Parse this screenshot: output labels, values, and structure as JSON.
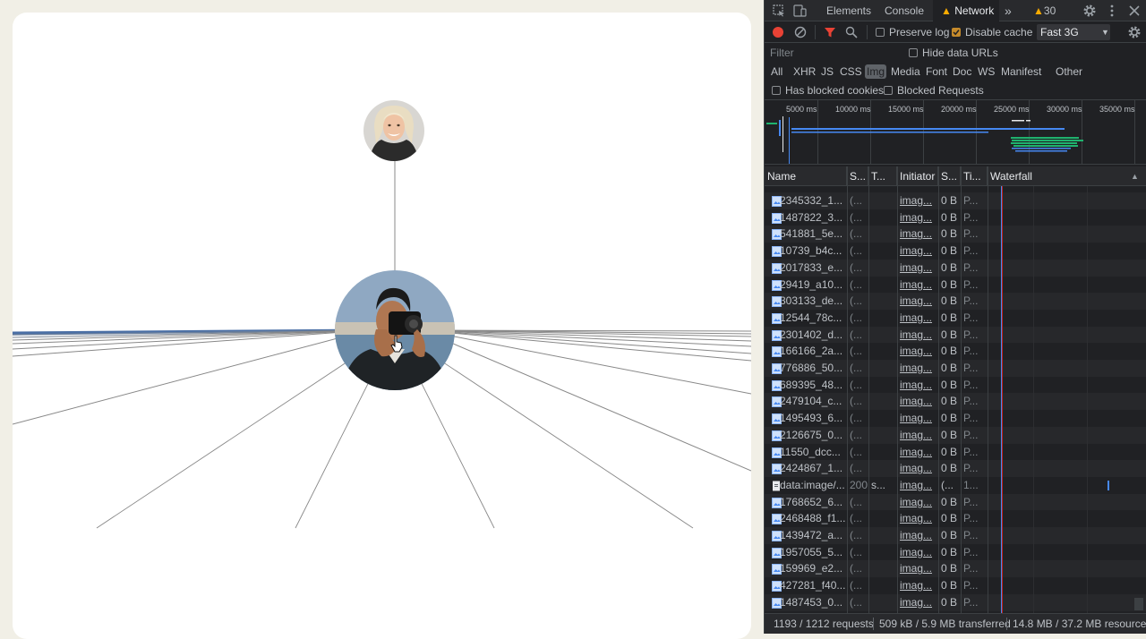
{
  "devtools": {
    "tabs": [
      "Elements",
      "Console",
      "Network"
    ],
    "selected_tab": "Network",
    "warning_count": "30",
    "toolbar": {
      "preserve_log": "Preserve log",
      "preserve_log_checked": false,
      "disable_cache": "Disable cache",
      "disable_cache_checked": true,
      "throttling": "Fast 3G"
    },
    "filter": {
      "placeholder": "Filter",
      "hide_data_urls": "Hide data URLs"
    },
    "types": [
      "All",
      "XHR",
      "JS",
      "CSS",
      "Img",
      "Media",
      "Font",
      "Doc",
      "WS",
      "Manifest",
      "Other"
    ],
    "selected_type": "Img",
    "has_blocked_cookies": "Has blocked cookies",
    "blocked_requests": "Blocked Requests",
    "overview_ticks": [
      "5000 ms",
      "10000 ms",
      "15000 ms",
      "20000 ms",
      "25000 ms",
      "30000 ms",
      "35000 ms"
    ],
    "columns": [
      "Name",
      "S...",
      "T...",
      "Initiator",
      "S...",
      "Ti...",
      "Waterfall"
    ],
    "rows": [
      {
        "name": "2345332_1...",
        "status": "(...",
        "type": "",
        "initiator": "imag...",
        "size": "0 B",
        "time": "P..."
      },
      {
        "name": "1487822_3...",
        "status": "(...",
        "type": "",
        "initiator": "imag...",
        "size": "0 B",
        "time": "P..."
      },
      {
        "name": "541881_5e...",
        "status": "(...",
        "type": "",
        "initiator": "imag...",
        "size": "0 B",
        "time": "P..."
      },
      {
        "name": "10739_b4c...",
        "status": "(...",
        "type": "",
        "initiator": "imag...",
        "size": "0 B",
        "time": "P..."
      },
      {
        "name": "2017833_e...",
        "status": "(...",
        "type": "",
        "initiator": "imag...",
        "size": "0 B",
        "time": "P..."
      },
      {
        "name": "29419_a10...",
        "status": "(...",
        "type": "",
        "initiator": "imag...",
        "size": "0 B",
        "time": "P..."
      },
      {
        "name": "303133_de...",
        "status": "(...",
        "type": "",
        "initiator": "imag...",
        "size": "0 B",
        "time": "P..."
      },
      {
        "name": "12544_78c...",
        "status": "(...",
        "type": "",
        "initiator": "imag...",
        "size": "0 B",
        "time": "P..."
      },
      {
        "name": "2301402_d...",
        "status": "(...",
        "type": "",
        "initiator": "imag...",
        "size": "0 B",
        "time": "P..."
      },
      {
        "name": "166166_2a...",
        "status": "(...",
        "type": "",
        "initiator": "imag...",
        "size": "0 B",
        "time": "P..."
      },
      {
        "name": "776886_50...",
        "status": "(...",
        "type": "",
        "initiator": "imag...",
        "size": "0 B",
        "time": "P..."
      },
      {
        "name": "689395_48...",
        "status": "(...",
        "type": "",
        "initiator": "imag...",
        "size": "0 B",
        "time": "P..."
      },
      {
        "name": "2479104_c...",
        "status": "(...",
        "type": "",
        "initiator": "imag...",
        "size": "0 B",
        "time": "P..."
      },
      {
        "name": "1495493_6...",
        "status": "(...",
        "type": "",
        "initiator": "imag...",
        "size": "0 B",
        "time": "P..."
      },
      {
        "name": "2126675_0...",
        "status": "(...",
        "type": "",
        "initiator": "imag...",
        "size": "0 B",
        "time": "P..."
      },
      {
        "name": "11550_dcc...",
        "status": "(...",
        "type": "",
        "initiator": "imag...",
        "size": "0 B",
        "time": "P..."
      },
      {
        "name": "2424867_1...",
        "status": "(...",
        "type": "",
        "initiator": "imag...",
        "size": "0 B",
        "time": "P..."
      },
      {
        "name": "data:image/...",
        "status": "200",
        "type": "s...",
        "initiator": "imag...",
        "size": "(...",
        "time": "1..."
      },
      {
        "name": "1768652_6...",
        "status": "(...",
        "type": "",
        "initiator": "imag...",
        "size": "0 B",
        "time": "P..."
      },
      {
        "name": "2468488_f1...",
        "status": "(...",
        "type": "",
        "initiator": "imag...",
        "size": "0 B",
        "time": "P..."
      },
      {
        "name": "1439472_a...",
        "status": "(...",
        "type": "",
        "initiator": "imag...",
        "size": "0 B",
        "time": "P..."
      },
      {
        "name": "1957055_5...",
        "status": "(...",
        "type": "",
        "initiator": "imag...",
        "size": "0 B",
        "time": "P..."
      },
      {
        "name": "159969_e2...",
        "status": "(...",
        "type": "",
        "initiator": "imag...",
        "size": "0 B",
        "time": "P..."
      },
      {
        "name": "427281_f40...",
        "status": "(...",
        "type": "",
        "initiator": "imag...",
        "size": "0 B",
        "time": "P..."
      },
      {
        "name": "1487453_0...",
        "status": "(...",
        "type": "",
        "initiator": "imag...",
        "size": "0 B",
        "time": "P..."
      }
    ],
    "status_bar": {
      "requests": "1193 / 1212 requests",
      "transferred": "509 kB / 5.9 MB transferred",
      "resources": "14.8 MB / 37.2 MB resources"
    },
    "colors": {
      "record": "#e94235",
      "filter_active": "#e94235",
      "warning": "#f9ab00",
      "accent_blue": "#4688f1",
      "accent_green": "#1fb36e"
    }
  }
}
